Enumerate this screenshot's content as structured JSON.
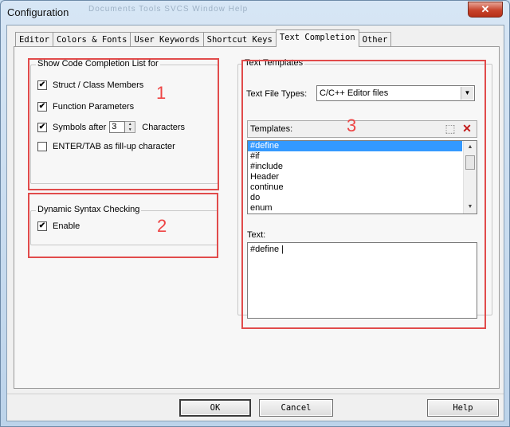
{
  "window": {
    "title": "Configuration",
    "close_glyph": "✕",
    "background_menu_text": "Documents  Tools  SVCS  Window  Help"
  },
  "tabs": [
    {
      "label": "Editor"
    },
    {
      "label": "Colors & Fonts"
    },
    {
      "label": "User Keywords"
    },
    {
      "label": "Shortcut Keys"
    },
    {
      "label": "Text Completion",
      "active": true
    },
    {
      "label": "Other"
    }
  ],
  "code_completion": {
    "legend": "Show Code Completion List for",
    "struct_members": {
      "label": "Struct / Class Members",
      "checked": true
    },
    "function_params": {
      "label": "Function Parameters",
      "checked": true
    },
    "symbols_after": {
      "label": "Symbols after",
      "value": "3",
      "suffix": "Characters",
      "checked": true
    },
    "enter_tab": {
      "label": "ENTER/TAB as fill-up character",
      "checked": false
    }
  },
  "syntax_checking": {
    "legend": "Dynamic Syntax Checking",
    "enable": {
      "label": "Enable",
      "checked": true
    }
  },
  "text_templates": {
    "legend": "Text Templates",
    "file_types_label": "Text File Types:",
    "file_types_value": "C/C++ Editor files",
    "templates_label": "Templates:",
    "items": [
      "#define",
      "#if",
      "#include",
      "Header",
      "continue",
      "do",
      "enum"
    ],
    "selected_index": 0,
    "text_label": "Text:",
    "text_value": "#define |"
  },
  "annotations": [
    "1",
    "2",
    "3"
  ],
  "buttons": {
    "ok": "OK",
    "cancel": "Cancel",
    "help": "Help"
  },
  "colors": {
    "annotation_red": "#e14b4b",
    "selection_blue": "#3399ff"
  },
  "glyphs": {
    "check": "✔",
    "up": "▲",
    "down": "▼",
    "new_template": "⬚",
    "delete_template": "✕"
  }
}
